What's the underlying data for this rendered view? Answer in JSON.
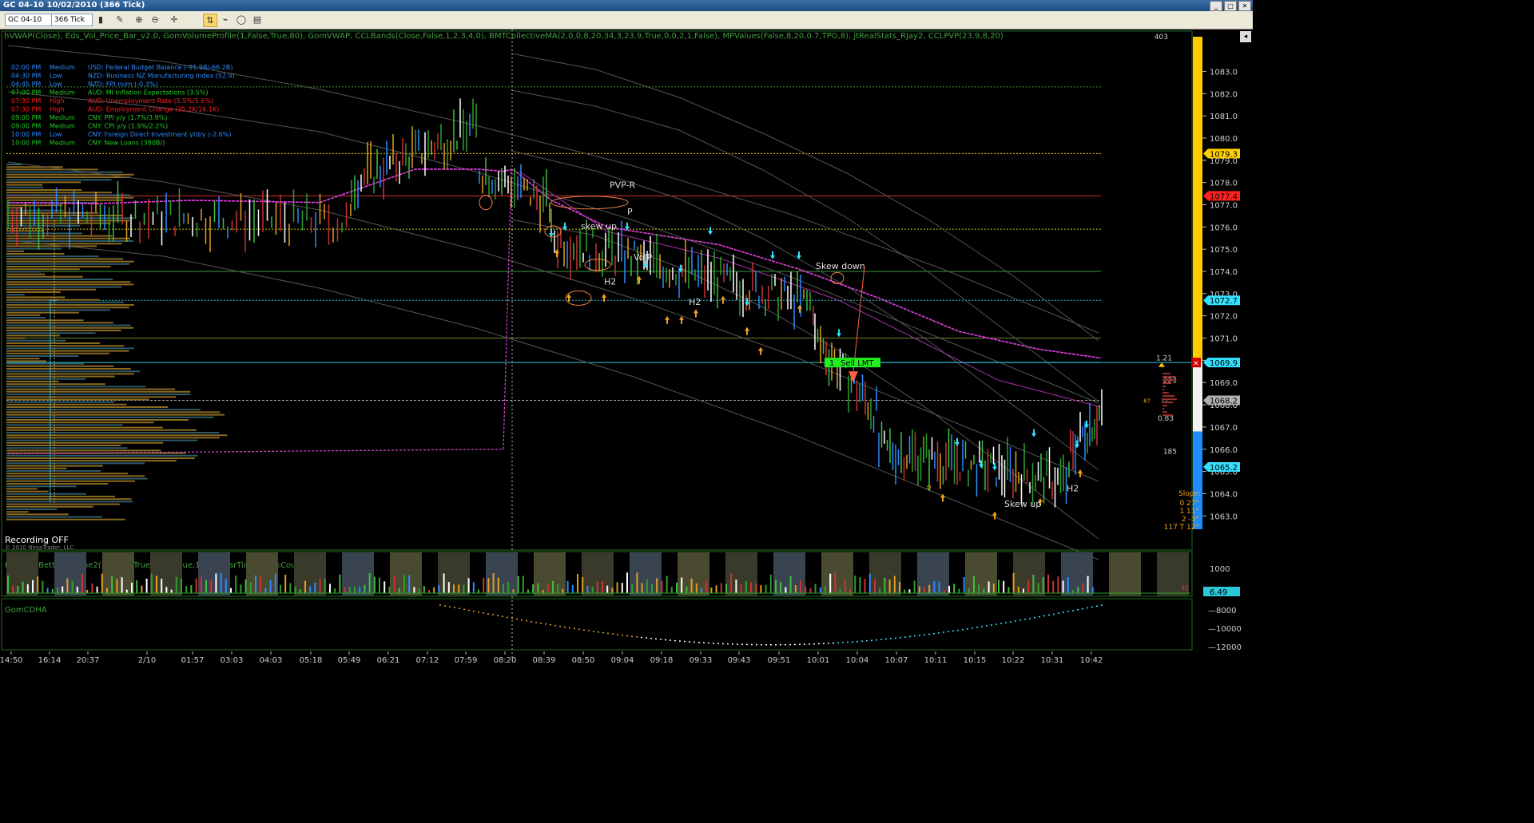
{
  "window": {
    "title": "GC 04-10  10/02/2010 (366 Tick)"
  },
  "toolbar": {
    "instrument": "GC 04-10",
    "period": "366 Tick"
  },
  "indicators_line": "hVWAP(Close), Eds_Vol_Price_Bar_v2.0, GomVolumeProfile(1,False,True,80), GomVWAP, CCLBands(Close,False,1,2,3,4,0), BMTCollectiveMA(2,0,0,8,20,34,3,23.9,True,0,0,2,1,False), MPValues(False,8,20,0.7,TPO,8), jtRealStats_RJay2, CCLPVP(23.9,8,20)",
  "news": [
    {
      "time": "02:00 PM",
      "impact": "Medium",
      "text": "USD: Federal Budget Balance (-91.9B/-66.2B)",
      "color": "#2e8bff"
    },
    {
      "time": "04:30 PM",
      "impact": "Low",
      "text": "NZD: Business NZ Manufacturing Index (52.9)",
      "color": "#2e8bff"
    },
    {
      "time": "04:45 PM",
      "impact": "Low",
      "text": "NZD: FPI m/m (-0.3%)",
      "color": "#2e8bff"
    },
    {
      "time": "07:00 PM",
      "impact": "Medium",
      "text": "AUD: MI Inflation Expectations (3.5%)",
      "color": "#22cc22"
    },
    {
      "time": "07:30 PM",
      "impact": "High",
      "text": "AUD: Unemployment Rate (5.5%/5.6%)",
      "color": "#ff2020"
    },
    {
      "time": "07:30 PM",
      "impact": "High",
      "text": "AUD: Employment Change (35.2K/16.1K)",
      "color": "#ff2020"
    },
    {
      "time": "09:00 PM",
      "impact": "Medium",
      "text": "CNY: PPI y/y (1.7%/3.9%)",
      "color": "#22cc22"
    },
    {
      "time": "09:00 PM",
      "impact": "Medium",
      "text": "CNY: CPI y/y (1.9%/2.2%)",
      "color": "#22cc22"
    },
    {
      "time": "10:00 PM",
      "impact": "Low",
      "text": "CNY: Foreign Direct Investment ytd/y (-2.6%)",
      "color": "#2e8bff"
    },
    {
      "time": "10:00 PM",
      "impact": "Medium",
      "text": "CNY: New Loans (380B/)",
      "color": "#22cc22"
    }
  ],
  "price_axis": {
    "ticks": [
      1083.0,
      1082.0,
      1081.0,
      1080.0,
      1079.0,
      1078.0,
      1077.0,
      1076.0,
      1075.0,
      1074.0,
      1073.0,
      1072.0,
      1071.0,
      1070.0,
      1069.0,
      1068.0,
      1067.0,
      1066.0,
      1065.0,
      1064.0,
      1063.0
    ],
    "range": [
      1062.4,
      1084.2
    ]
  },
  "price_markers": [
    {
      "value": "1079.3",
      "price": 1079.3,
      "color": "#ffd000"
    },
    {
      "value": "1077.4",
      "price": 1077.4,
      "color": "#ff2020"
    },
    {
      "value": "1072.7",
      "price": 1072.7,
      "color": "#33e0ff"
    },
    {
      "value": "1069.9",
      "price": 1069.9,
      "color": "#33e0ff"
    },
    {
      "value": "1068.2",
      "price": 1068.2,
      "color": "#b0b0b0"
    },
    {
      "value": "1065.2",
      "price": 1065.2,
      "color": "#33e0ff"
    }
  ],
  "time_axis": [
    "14:50",
    "16:14",
    "20:37",
    "2/10",
    "01:57",
    "03:03",
    "04:03",
    "05:18",
    "05:49",
    "06:21",
    "07:12",
    "07:59",
    "08:20",
    "08:39",
    "08:50",
    "09:04",
    "09:18",
    "09:33",
    "09:43",
    "09:51",
    "10:01",
    "10:04",
    "10:07",
    "10:11",
    "10:15",
    "10:22",
    "10:31",
    "10:42"
  ],
  "annotations": {
    "pvp_r": "PVP-R",
    "p": "P",
    "skew_up_1": "skew up",
    "vol_p": "VolP",
    "h2_1": "H2",
    "h2_2": "H2",
    "skew_down": "Skew down",
    "skew_up_2": "Skew up",
    "h2_3": "H2",
    "d": "D"
  },
  "order": {
    "qty": "1",
    "label": "Sell LMT",
    "price": "1069.9"
  },
  "stats": {
    "top": "403",
    "r121": "1.21",
    "r223": "223",
    "r87": "87",
    "r17": "17",
    "r083": "0.83",
    "r185": "185",
    "slope_title": "Slope:",
    "slope_rows": [
      "0  27°",
      "1  11°",
      "2  -3°",
      "117 T  12°"
    ]
  },
  "recording": "Recording OFF",
  "copyright": "© 2010 NinjaTrader, LLC",
  "panel2": {
    "label": "RPM(6), BetterVolume2(21,True,True,False,True,1), AshBarTimer, TickCounter2",
    "ticks": [
      "1000",
      "0"
    ],
    "value": "6.49",
    "bar_count": "42"
  },
  "panel3": {
    "label": "GomCDHA",
    "ticks": [
      "-8000",
      "-10000",
      "-12000"
    ]
  }
}
